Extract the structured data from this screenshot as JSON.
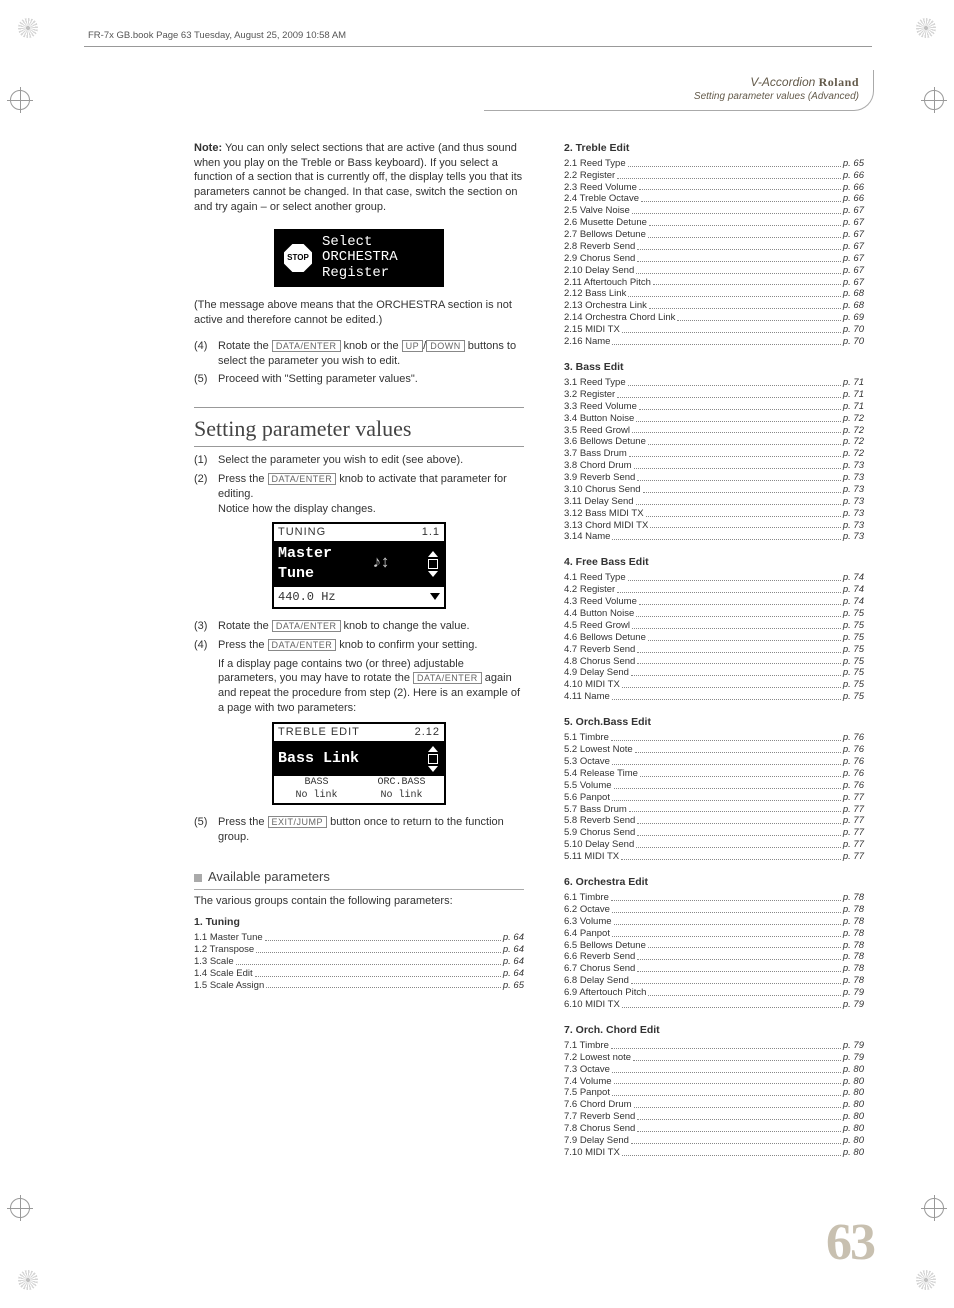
{
  "meta": {
    "bookHeader": "FR-7x GB.book  Page 63  Tuesday, August 25, 2009  10:58 AM",
    "brandLine": "V-Accordion",
    "brandName": "Roland",
    "chapterSubtitle": "Setting parameter values (Advanced)",
    "pageNumber": "63"
  },
  "left": {
    "noteLabel": "Note:",
    "noteText": " You can only select sections that are active (and thus sound when you play on the Treble or Bass keyboard). If you select a function of a section that is currently off, the display tells you that its parameters cannot be changed. In that case, switch the section on and try again – or select another group.",
    "stopIconText": "STOP",
    "stopLine1": "Select",
    "stopLine2": "ORCHESTRA",
    "stopLine3": "Register",
    "postStop": "(The message above means that the ORCHESTRA section is not active and therefore cannot be edited.)",
    "step4a_num": "(4)",
    "step4a_a": "Rotate the ",
    "step4a_key1": "DATA/ENTER",
    "step4a_b": " knob or the ",
    "step4a_key2": "UP",
    "step4a_c": "/",
    "step4a_key3": "DOWN",
    "step4a_d": " buttons to select the parameter you wish to edit.",
    "step5a_num": "(5)",
    "step5a": "Proceed with \"Setting parameter values\".",
    "sectionTitle": "Setting parameter values",
    "s1_num": "(1)",
    "s1": "Select the parameter you wish to edit (see above).",
    "s2_num": "(2)",
    "s2_a": "Press the ",
    "s2_key": "DATA/ENTER",
    "s2_b": " knob to activate that parameter for editing.",
    "s2_sub": "Notice how the display changes.",
    "lcd1_top_l": "TUNING",
    "lcd1_top_r": "1.1",
    "lcd1_mid_l1": "Master",
    "lcd1_mid_l2": "Tune",
    "lcd1_bottom": "440.0 Hz",
    "s3_num": "(3)",
    "s3_a": "Rotate the ",
    "s3_key": "DATA/ENTER",
    "s3_b": " knob to change the value.",
    "s4_num": "(4)",
    "s4_a": "Press the ",
    "s4_key": "DATA/ENTER",
    "s4_b": " knob to confirm your setting.",
    "s4_sub_a": "If a display page contains two (or three) adjustable parameters, you may have to rotate the ",
    "s4_sub_key": "DATA/ENTER",
    "s4_sub_b": " again and repeat the procedure from step (2). Here is an example of a page with two parameters:",
    "lcd2_top_l": "TREBLE EDIT",
    "lcd2_top_r": "2.12",
    "lcd2_mid": "Bass Link",
    "lcd2_c1h": "BASS",
    "lcd2_c1v": "No link",
    "lcd2_c2h": "ORC.BASS",
    "lcd2_c2v": "No link",
    "s5_num": "(5)",
    "s5_a": "Press the ",
    "s5_key": "EXIT/JUMP",
    "s5_b": " button once to return to the function group.",
    "availTitle": "Available parameters",
    "availIntro": "The various groups contain the following parameters:"
  },
  "tocGroups": [
    {
      "title": "1. Tuning",
      "col": "left",
      "items": [
        {
          "l": "1.1 Master Tune",
          "p": "p. 64"
        },
        {
          "l": "1.2 Transpose",
          "p": "p. 64"
        },
        {
          "l": "1.3 Scale",
          "p": "p. 64"
        },
        {
          "l": "1.4 Scale Edit",
          "p": "p. 64"
        },
        {
          "l": "1.5 Scale Assign",
          "p": "p. 65"
        }
      ]
    },
    {
      "title": "2. Treble Edit",
      "col": "right",
      "items": [
        {
          "l": "2.1 Reed Type",
          "p": "p. 65"
        },
        {
          "l": "2.2 Register",
          "p": "p. 66"
        },
        {
          "l": "2.3 Reed Volume",
          "p": "p. 66"
        },
        {
          "l": "2.4 Treble Octave",
          "p": "p. 66"
        },
        {
          "l": "2.5 Valve Noise",
          "p": "p. 67"
        },
        {
          "l": "2.6 Musette Detune",
          "p": "p. 67"
        },
        {
          "l": "2.7 Bellows Detune",
          "p": "p. 67"
        },
        {
          "l": "2.8 Reverb Send",
          "p": "p. 67"
        },
        {
          "l": "2.9 Chorus Send",
          "p": "p. 67"
        },
        {
          "l": "2.10 Delay Send",
          "p": "p. 67"
        },
        {
          "l": "2.11 Aftertouch Pitch",
          "p": "p. 67"
        },
        {
          "l": "2.12 Bass Link",
          "p": "p. 68"
        },
        {
          "l": "2.13 Orchestra Link",
          "p": "p. 68"
        },
        {
          "l": "2.14 Orchestra Chord Link",
          "p": "p. 69"
        },
        {
          "l": "2.15 MIDI TX",
          "p": "p. 70"
        },
        {
          "l": "2.16 Name",
          "p": "p. 70"
        }
      ]
    },
    {
      "title": "3. Bass Edit",
      "col": "right",
      "items": [
        {
          "l": "3.1 Reed Type",
          "p": "p. 71"
        },
        {
          "l": "3.2 Register",
          "p": "p. 71"
        },
        {
          "l": "3.3 Reed Volume",
          "p": "p. 71"
        },
        {
          "l": "3.4 Button Noise",
          "p": "p. 72"
        },
        {
          "l": "3.5 Reed Growl",
          "p": "p. 72"
        },
        {
          "l": "3.6 Bellows Detune",
          "p": "p. 72"
        },
        {
          "l": "3.7 Bass Drum",
          "p": "p. 72"
        },
        {
          "l": "3.8 Chord Drum",
          "p": "p. 73"
        },
        {
          "l": "3.9 Reverb Send",
          "p": "p. 73"
        },
        {
          "l": "3.10 Chorus Send",
          "p": "p. 73"
        },
        {
          "l": "3.11 Delay Send",
          "p": "p. 73"
        },
        {
          "l": "3.12 Bass MIDI TX",
          "p": "p. 73"
        },
        {
          "l": "3.13 Chord MIDI TX",
          "p": "p. 73"
        },
        {
          "l": "3.14 Name",
          "p": "p. 73"
        }
      ]
    },
    {
      "title": "4. Free Bass Edit",
      "col": "right",
      "items": [
        {
          "l": "4.1 Reed Type",
          "p": "p. 74"
        },
        {
          "l": "4.2 Register",
          "p": "p. 74"
        },
        {
          "l": "4.3 Reed Volume",
          "p": "p. 74"
        },
        {
          "l": "4.4 Button Noise",
          "p": "p. 75"
        },
        {
          "l": "4.5 Reed Growl",
          "p": "p. 75"
        },
        {
          "l": "4.6 Bellows Detune",
          "p": "p. 75"
        },
        {
          "l": "4.7 Reverb Send",
          "p": "p. 75"
        },
        {
          "l": "4.8 Chorus Send",
          "p": "p. 75"
        },
        {
          "l": "4.9 Delay Send",
          "p": "p. 75"
        },
        {
          "l": "4.10 MIDI TX",
          "p": "p. 75"
        },
        {
          "l": "4.11 Name",
          "p": "p. 75"
        }
      ]
    },
    {
      "title": "5. Orch.Bass Edit",
      "col": "right",
      "items": [
        {
          "l": "5.1 Timbre",
          "p": "p. 76"
        },
        {
          "l": "5.2 Lowest Note",
          "p": "p. 76"
        },
        {
          "l": "5.3 Octave",
          "p": "p. 76"
        },
        {
          "l": "5.4 Release Time",
          "p": "p. 76"
        },
        {
          "l": "5.5 Volume",
          "p": "p. 76"
        },
        {
          "l": "5.6 Panpot",
          "p": "p. 77"
        },
        {
          "l": "5.7 Bass Drum",
          "p": "p. 77"
        },
        {
          "l": "5.8 Reverb Send",
          "p": "p. 77"
        },
        {
          "l": "5.9 Chorus Send",
          "p": "p. 77"
        },
        {
          "l": "5.10 Delay Send",
          "p": "p. 77"
        },
        {
          "l": "5.11 MIDI TX",
          "p": "p. 77"
        }
      ]
    },
    {
      "title": "6. Orchestra Edit",
      "col": "right",
      "items": [
        {
          "l": "6.1 Timbre",
          "p": "p. 78"
        },
        {
          "l": "6.2 Octave",
          "p": "p. 78"
        },
        {
          "l": "6.3 Volume",
          "p": "p. 78"
        },
        {
          "l": "6.4 Panpot",
          "p": "p. 78"
        },
        {
          "l": "6.5 Bellows Detune",
          "p": "p. 78"
        },
        {
          "l": "6.6 Reverb Send",
          "p": "p. 78"
        },
        {
          "l": "6.7 Chorus Send",
          "p": "p. 78"
        },
        {
          "l": "6.8 Delay Send",
          "p": "p. 78"
        },
        {
          "l": "6.9 Aftertouch Pitch",
          "p": "p. 79"
        },
        {
          "l": "6.10 MIDI TX",
          "p": "p. 79"
        }
      ]
    },
    {
      "title": "7. Orch. Chord Edit",
      "col": "right",
      "items": [
        {
          "l": "7.1 Timbre",
          "p": "p. 79"
        },
        {
          "l": "7.2 Lowest note",
          "p": "p. 79"
        },
        {
          "l": "7.3 Octave",
          "p": "p. 80"
        },
        {
          "l": "7.4 Volume",
          "p": "p. 80"
        },
        {
          "l": "7.5 Panpot",
          "p": "p. 80"
        },
        {
          "l": "7.6 Chord Drum",
          "p": "p. 80"
        },
        {
          "l": "7.7 Reverb Send",
          "p": "p. 80"
        },
        {
          "l": "7.8 Chorus Send",
          "p": "p. 80"
        },
        {
          "l": "7.9 Delay Send",
          "p": "p. 80"
        },
        {
          "l": "7.10 MIDI TX",
          "p": "p. 80"
        }
      ]
    }
  ]
}
